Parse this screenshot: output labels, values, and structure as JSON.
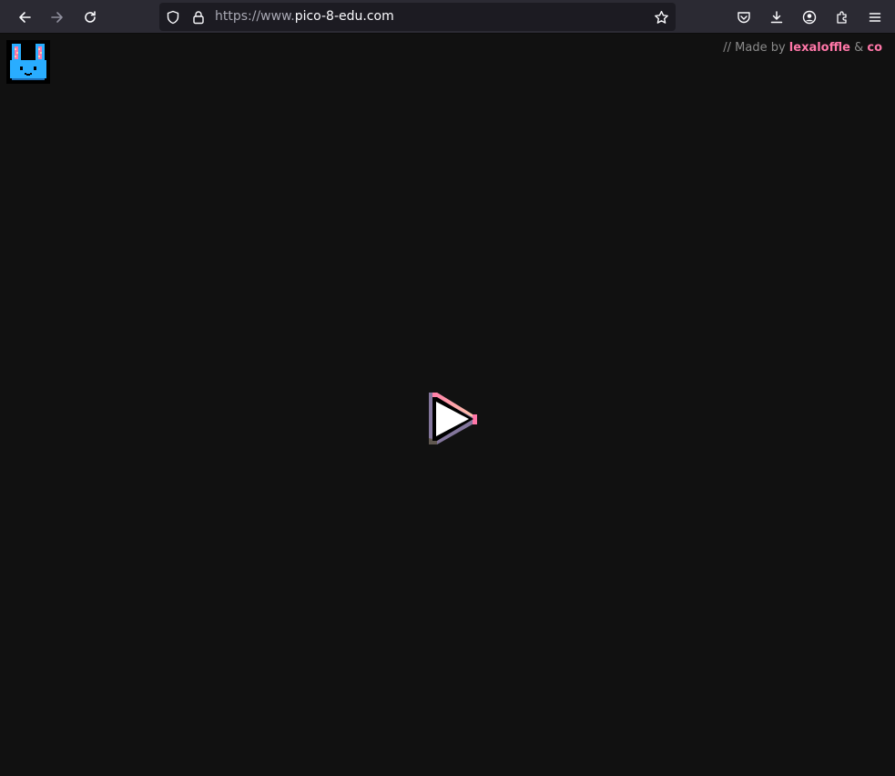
{
  "browser": {
    "url_scheme": "https://www.",
    "url_host": "pico-8-edu.com",
    "icons": {
      "back": "back-arrow-icon",
      "forward": "forward-arrow-icon",
      "reload": "reload-icon",
      "tracking": "shield-icon",
      "lock": "lock-icon",
      "bookmark": "star-icon",
      "pocket": "pocket-icon",
      "downloads": "download-icon",
      "account": "account-icon",
      "extensions": "puzzle-icon",
      "menu": "hamburger-menu-icon"
    }
  },
  "page": {
    "credits": {
      "prefix": "// Made by ",
      "author": "lexaloffle",
      "separator": " & ",
      "coauthor": "co"
    },
    "logo": "pixel-bunny-logo",
    "play": "play-button-icon",
    "colors": {
      "background": "#111111",
      "accent_pink": "#ff77a8",
      "logo_blue": "#29adff"
    }
  }
}
